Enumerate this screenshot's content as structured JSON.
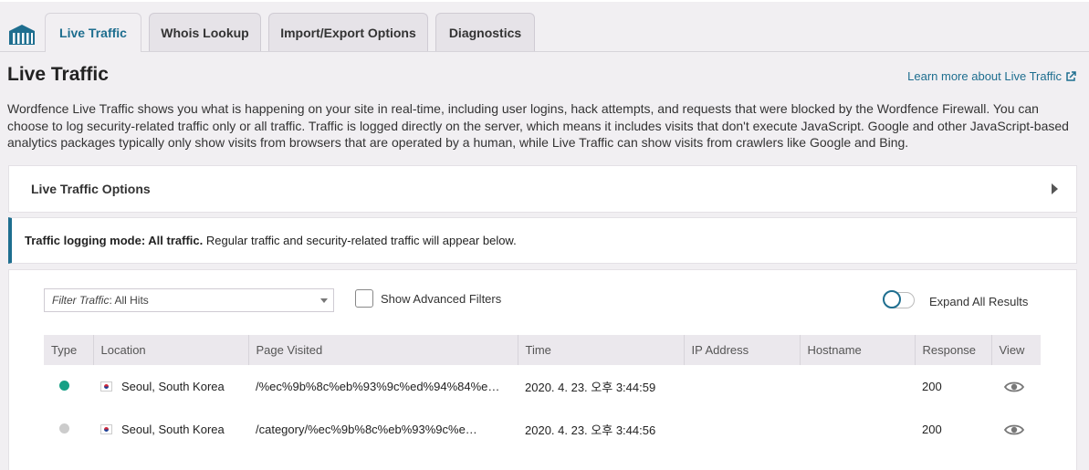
{
  "tabs": [
    {
      "label": "Live Traffic",
      "active": true
    },
    {
      "label": "Whois Lookup",
      "active": false
    },
    {
      "label": "Import/Export Options",
      "active": false
    },
    {
      "label": "Diagnostics",
      "active": false
    }
  ],
  "page": {
    "title": "Live Traffic",
    "learn_more": "Learn more about Live Traffic",
    "description": "Wordfence Live Traffic shows you what is happening on your site in real-time, including user logins, hack attempts, and requests that were blocked by the Wordfence Firewall. You can choose to log security-related traffic only or all traffic. Traffic is logged directly on the server, which means it includes visits that don't execute JavaScript. Google and other JavaScript-based analytics packages typically only show visits from browsers that are operated by a human, while Live Traffic can show visits from crawlers like Google and Bing."
  },
  "options_panel": {
    "label": "Live Traffic Options"
  },
  "mode": {
    "bold": "Traffic logging mode: All traffic.",
    "rest": " Regular traffic and security-related traffic will appear below."
  },
  "filters": {
    "filter_prefix": "Filter Traffic",
    "filter_value": ": All Hits",
    "advanced_label": "Show Advanced Filters",
    "expand_label": "Expand All Results"
  },
  "table": {
    "headers": [
      "Type",
      "Location",
      "Page Visited",
      "Time",
      "IP Address",
      "Hostname",
      "Response",
      "View"
    ],
    "rows": [
      {
        "type_color": "#16a085",
        "location": "Seoul, South Korea",
        "page": "/%ec%9b%8c%eb%93%9c%ed%94%84%e…",
        "time": "2020. 4. 23. 오후 3:44:59",
        "ip": "",
        "hostname": "",
        "response": "200"
      },
      {
        "type_color": "#cccccc",
        "location": "Seoul, South Korea",
        "page": "/category/%ec%9b%8c%eb%93%9c%e…",
        "time": "2020. 4. 23. 오후 3:44:56",
        "ip": "",
        "hostname": "",
        "response": "200"
      }
    ]
  },
  "colors": {
    "accent": "#1e6e8f",
    "background": "#f1eff2"
  }
}
